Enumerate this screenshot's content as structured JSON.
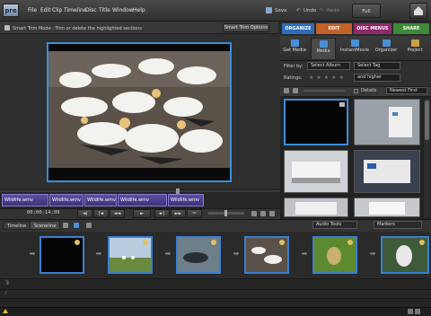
{
  "app": {
    "logo_text": "pre"
  },
  "menu": [
    "File",
    "Edit",
    "Clip",
    "Timeline",
    "Disc",
    "Title",
    "Window",
    "Help"
  ],
  "toolbar": {
    "save": "Save",
    "undo": "Undo",
    "redo": "Redo",
    "full_screen": "Full Screen"
  },
  "monitor": {
    "mode_text": "Smart Trim Mode : Trim or delete the highlighted sections",
    "smart_trim_options": "Smart Trim Options",
    "timecode": "00;00;14;09"
  },
  "clip_strip": [
    "Wildlife.wmv",
    "Wildlife.wmv",
    "Wildlife.wmv",
    "Wildlife.wmv",
    "Wildlife.wmv"
  ],
  "panel": {
    "tabs": [
      {
        "label": "ORGANIZE",
        "color": "#2f6db8"
      },
      {
        "label": "EDIT",
        "color": "#c0622a"
      },
      {
        "label": "DISC MENUS",
        "color": "#8e2b6a"
      },
      {
        "label": "SHARE",
        "color": "#3e8a38"
      }
    ],
    "org_buttons": [
      "Get Media",
      "Media",
      "InstantMovie",
      "Organizer",
      "Project"
    ],
    "filter_by_label": "Filter by:",
    "select_album": "Select Album",
    "select_tag": "Select Tag",
    "ratings_label": "Ratings:",
    "and_higher": "and higher",
    "details_label": "Details",
    "sort": "Newest First"
  },
  "timeline": {
    "tabs": [
      "Timeline",
      "Sceneline"
    ],
    "audio_tools": "Audio Tools",
    "markers": "Markers"
  },
  "colors": {
    "accent": "#3b8fd8",
    "clip_purple": "#5b4fa3"
  }
}
